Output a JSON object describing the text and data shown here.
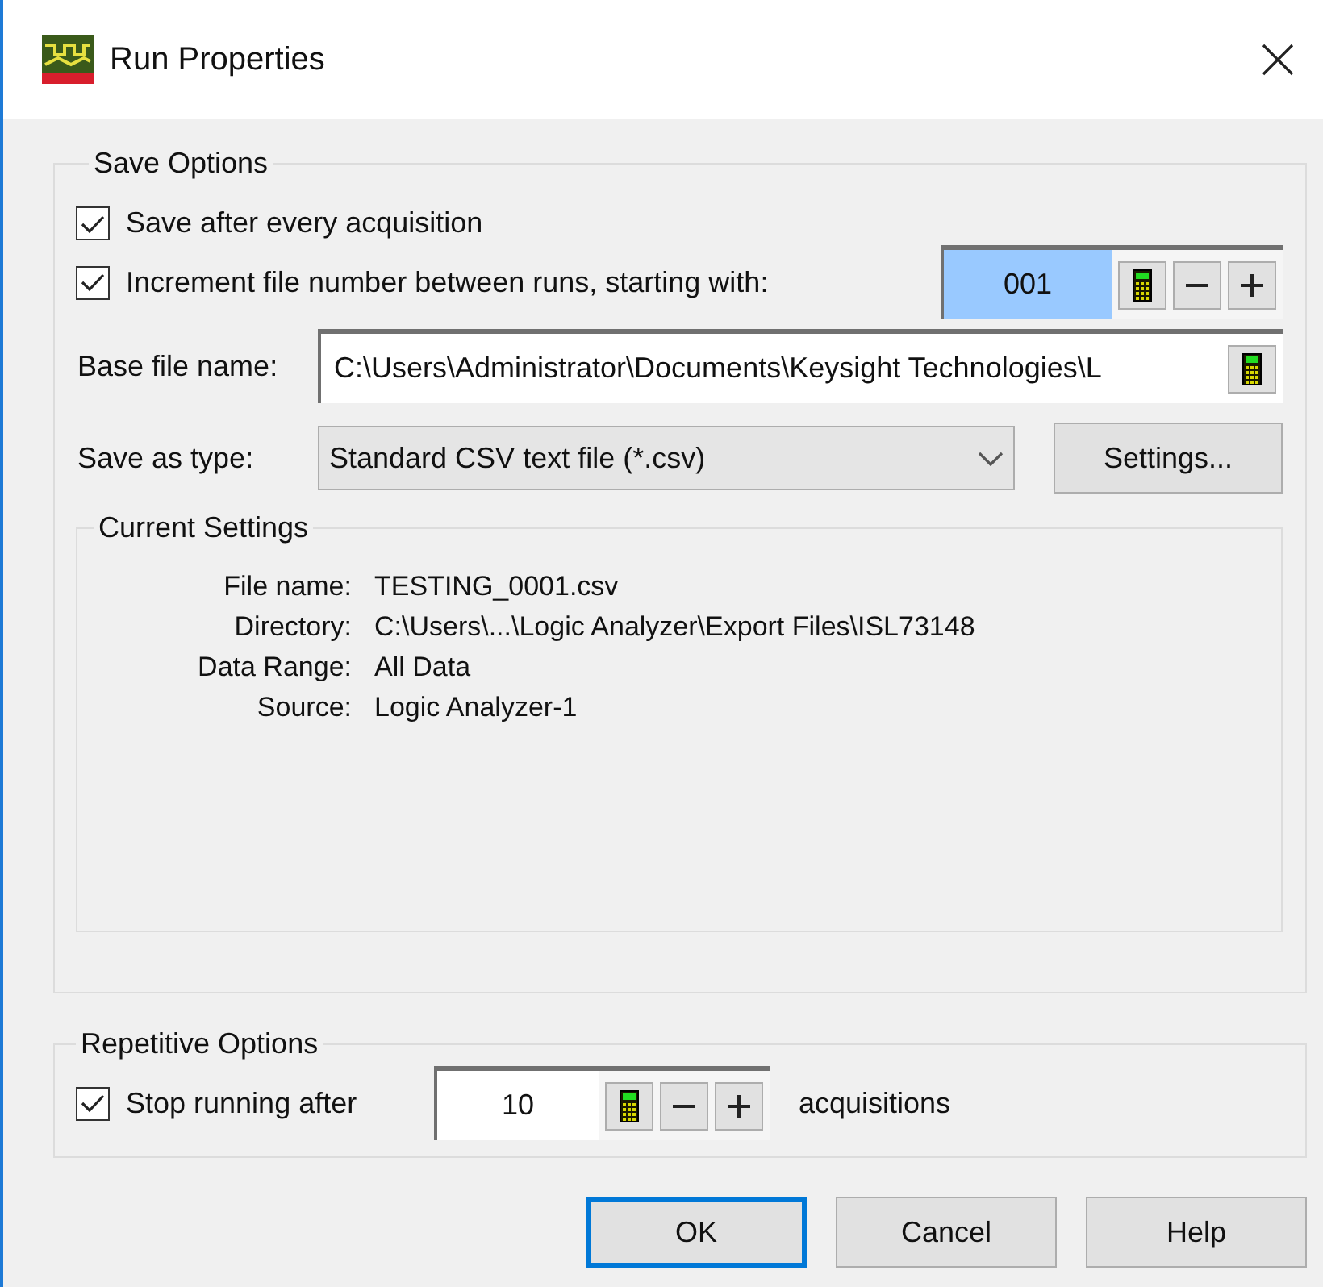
{
  "window": {
    "title": "Run Properties"
  },
  "save_options": {
    "title": "Save Options",
    "save_after": {
      "label": "Save after every acquisition",
      "checked": true
    },
    "increment": {
      "label": "Increment file number between runs, starting with:",
      "checked": true,
      "value": "001",
      "selected": true
    },
    "base_file_name": {
      "label": "Base file name:",
      "value": "C:\\Users\\Administrator\\Documents\\Keysight Technologies\\L"
    },
    "save_as_type": {
      "label": "Save as type:",
      "value": "Standard CSV text file (*.csv)"
    },
    "settings_button": "Settings...",
    "current_settings": {
      "title": "Current Settings",
      "rows": [
        {
          "label": "File name:",
          "value": "TESTING_0001.csv"
        },
        {
          "label": "Directory:",
          "value": "C:\\Users\\...\\Logic Analyzer\\Export Files\\ISL73148"
        },
        {
          "label": "Data Range:",
          "value": "All Data"
        },
        {
          "label": "Source:",
          "value": "Logic Analyzer-1"
        }
      ]
    }
  },
  "repetitive_options": {
    "title": "Repetitive Options",
    "stop": {
      "label": "Stop running after",
      "checked": true,
      "value": "10",
      "selected": false,
      "suffix": "acquisitions"
    }
  },
  "buttons": [
    {
      "label": "OK",
      "default": true
    },
    {
      "label": "Cancel",
      "default": false
    },
    {
      "label": "Help",
      "default": false
    }
  ]
}
